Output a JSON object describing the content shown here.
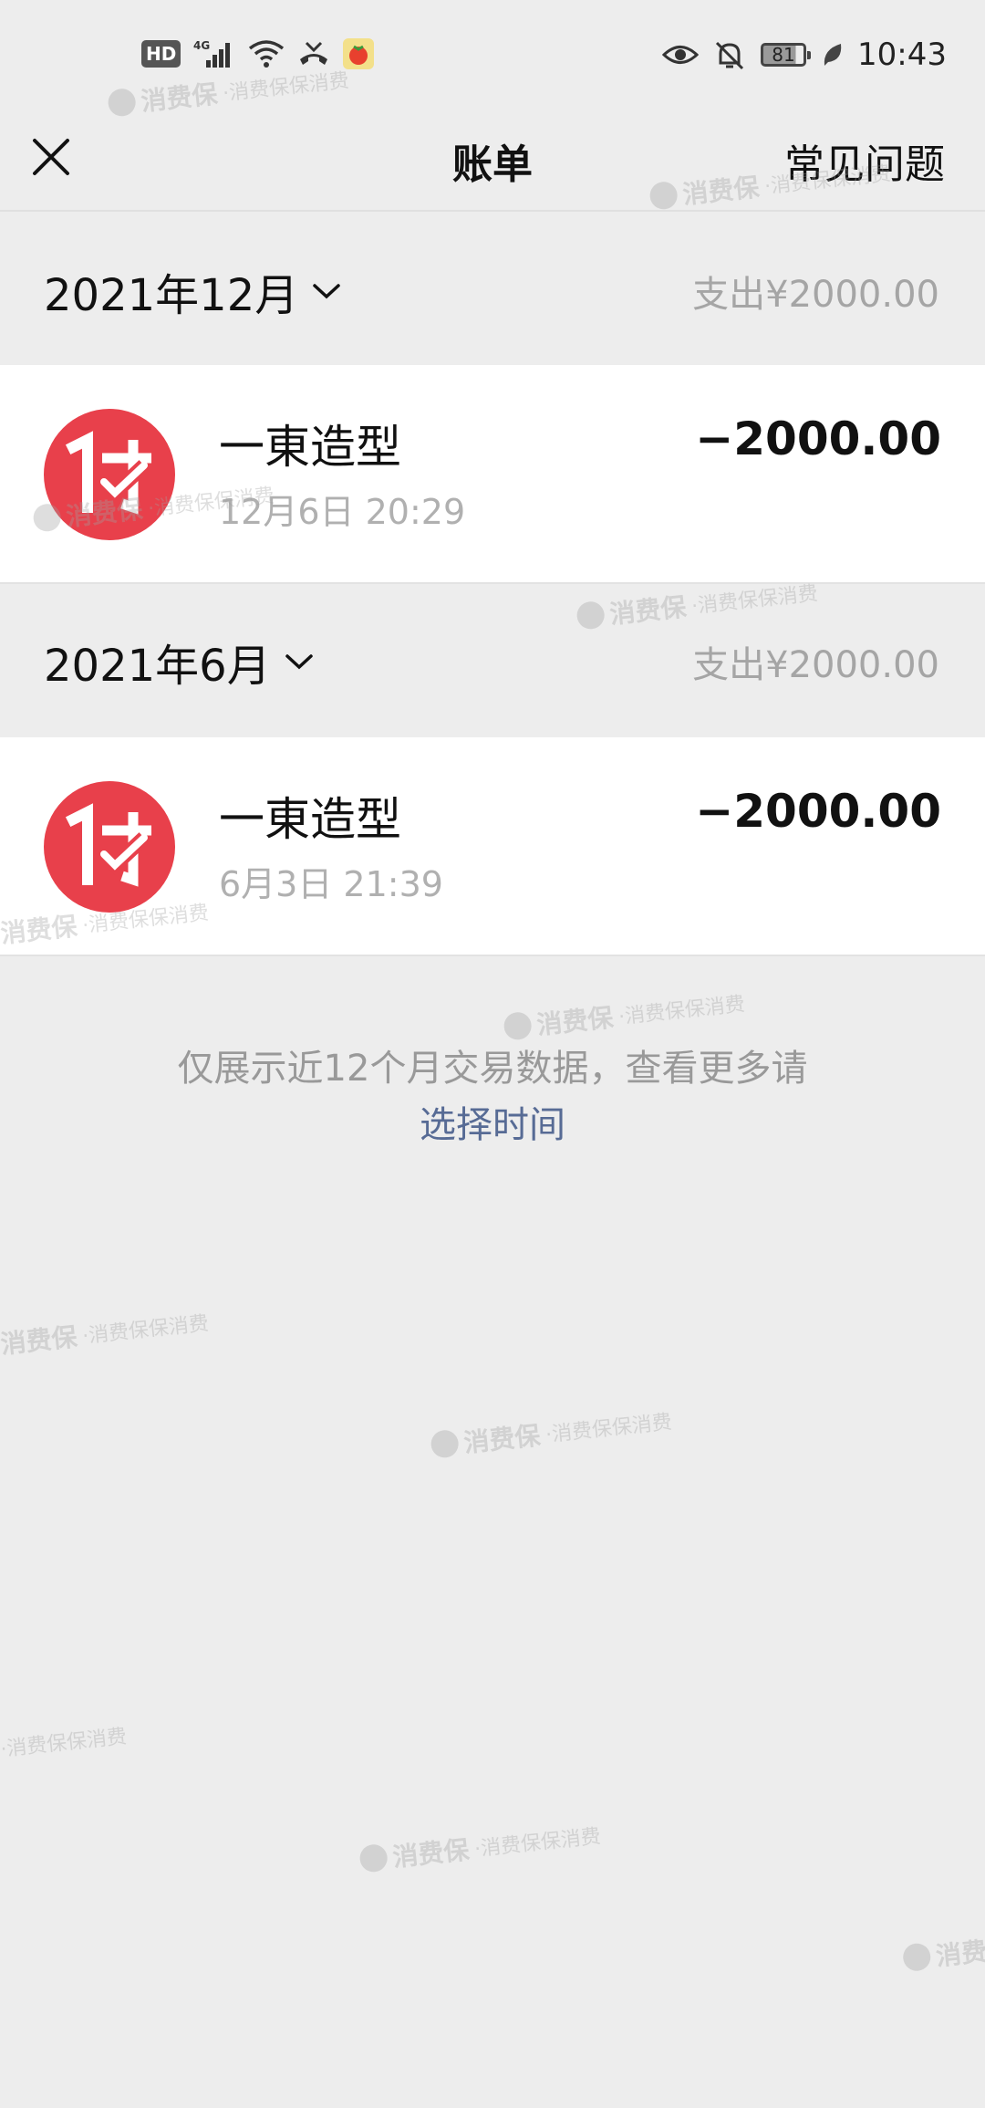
{
  "status_bar": {
    "hd_badge": "HD",
    "network": "4G",
    "battery_level": "81",
    "time": "10:43"
  },
  "title_bar": {
    "title": "账单",
    "faq_label": "常见问题"
  },
  "months": [
    {
      "label": "2021年12月",
      "total": "支出¥2000.00",
      "transactions": [
        {
          "merchant": "一東造型",
          "time": "12月6日 20:29",
          "amount": "−2000.00"
        }
      ]
    },
    {
      "label": "2021年6月",
      "total": "支出¥2000.00",
      "transactions": [
        {
          "merchant": "一東造型",
          "time": "6月3日 21:39",
          "amount": "−2000.00"
        }
      ]
    }
  ],
  "footer": {
    "note": "仅展示近12个月交易数据，查看更多请",
    "link_label": "选择时间"
  },
  "watermark": {
    "main": "消费保",
    "tail": "·消费保保消费"
  },
  "colors": {
    "payment_icon_red": "#e8404b",
    "link_blue": "#576b95",
    "background": "#ededed"
  }
}
